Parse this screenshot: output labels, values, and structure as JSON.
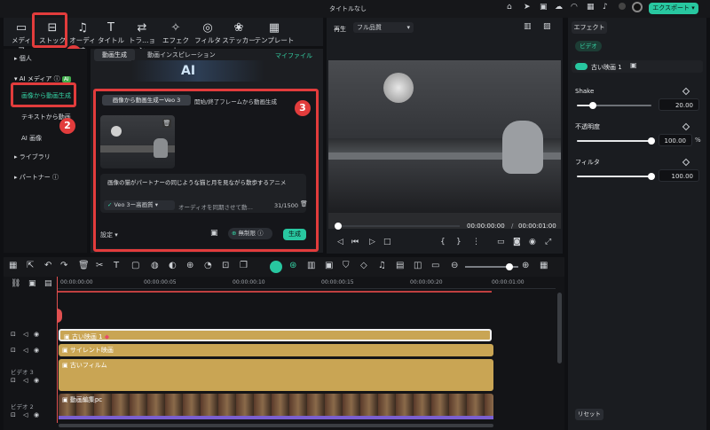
{
  "window": {
    "title": "タイトルなし",
    "export_label": "エクスポート"
  },
  "media_toolbar": {
    "items": [
      {
        "label": "メディア",
        "glyph": "▭"
      },
      {
        "label": "ストック",
        "glyph": "⊟"
      },
      {
        "label": "オーディオ",
        "glyph": "♫"
      },
      {
        "label": "タイトル",
        "glyph": "T"
      },
      {
        "label": "トラ…ョン",
        "glyph": "⇄"
      },
      {
        "label": "エフェクト",
        "glyph": "✧"
      },
      {
        "label": "フィルター",
        "glyph": "◎"
      },
      {
        "label": "ステッカー",
        "glyph": "❀"
      },
      {
        "label": "テンプレート",
        "glyph": "▦"
      }
    ]
  },
  "sidebar": {
    "personal": "個人",
    "ai_media": "AI メディア",
    "ai_badge": "AI",
    "image_to_video": "画像から動画生成",
    "text_to_video": "テキストから動画",
    "ai_image": "AI 画像",
    "library": "ライブラリ",
    "partner": "パートナー"
  },
  "content": {
    "tab_generate": "動画生成",
    "tab_inspiration": "動画インスピレーション",
    "my_files": "マイファイル",
    "banner_text": "AI",
    "subtab_image_to_video": "画像から動画生成ーVeo 3",
    "subtab_frames": "開始/終了フレームから動画生成",
    "prompt_text": "画像の猫がパートナーの同じような猫と月を見ながら散歩するアニメ",
    "model_label": "Veo 3ー高画質",
    "audio_placeholder": "オーディオを同期させて動…",
    "char_count": "31/1500",
    "settings_label": "設定",
    "free_label": "無制限",
    "generate_label": "生成"
  },
  "player": {
    "play_label": "再生",
    "quality": "フル品質",
    "time_current": "00:00:00:00",
    "time_total": "00:00:01:00",
    "progress": 0.02
  },
  "effects_panel": {
    "tab": "エフェクト",
    "video_chip": "ビデオ",
    "effect_name": "古い映画 1",
    "shake_label": "Shake",
    "shake_value": "20.00",
    "shake_level": 0.22,
    "opacity_label": "不透明度",
    "opacity_value": "100.00",
    "opacity_unit": "%",
    "opacity_level": 1.0,
    "filter_label": "フィルタ",
    "filter_value": "100.00",
    "filter_level": 1.0,
    "reset_label": "リセット"
  },
  "timeline": {
    "ruler": [
      "00:00:00:00",
      "00:00:00:05",
      "00:00:00:10",
      "00:00:00:15",
      "00:00:00:20",
      "00:00:01:00"
    ],
    "clip_old_movie": "古い映画 1",
    "clip_silent": "サイレント映画",
    "clip_old_film": "古いフィルム",
    "clip_video": "動画編集pc",
    "track_video3": "ビデオ 3",
    "track_video2": "ビデオ 2"
  },
  "annotations": [
    "1",
    "2",
    "3"
  ],
  "colors": {
    "accent": "#28c7a0",
    "highlight": "#e23c3c",
    "clip_gold": "#c9a554",
    "playhead": "#e05050"
  }
}
